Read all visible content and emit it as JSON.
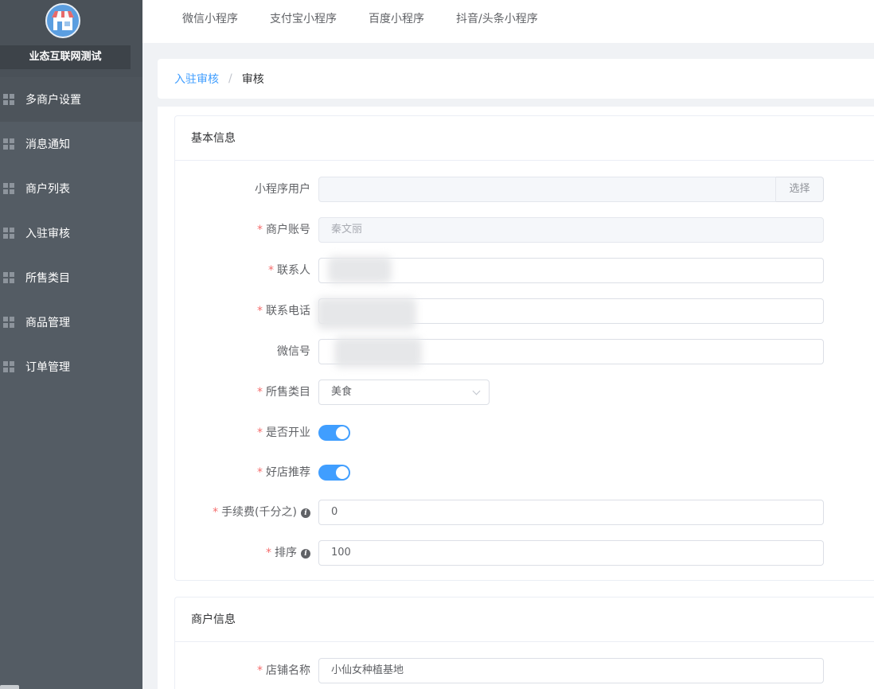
{
  "sidebar": {
    "brand_name": "业态互联网测试",
    "items": [
      {
        "label": "多商户设置",
        "active": true
      },
      {
        "label": "消息通知",
        "active": false
      },
      {
        "label": "商户列表",
        "active": false
      },
      {
        "label": "入驻审核",
        "active": false
      },
      {
        "label": "所售类目",
        "active": false
      },
      {
        "label": "商品管理",
        "active": false
      },
      {
        "label": "订单管理",
        "active": false
      }
    ]
  },
  "topbar": {
    "tabs": [
      "微信小程序",
      "支付宝小程序",
      "百度小程序",
      "抖音/头条小程序"
    ]
  },
  "breadcrumb": {
    "parent": "入驻审核",
    "separator": "/",
    "current": "审核"
  },
  "basic_info": {
    "title": "基本信息",
    "fields": {
      "mini_user": {
        "label": "小程序用户",
        "button": "选择",
        "value": ""
      },
      "account": {
        "label": "商户账号",
        "value": "秦文丽"
      },
      "contact": {
        "label": "联系人",
        "value": ""
      },
      "phone": {
        "label": "联系电话",
        "value": ""
      },
      "wechat": {
        "label": "微信号",
        "value": ""
      },
      "category": {
        "label": "所售类目",
        "value": "美食"
      },
      "is_open": {
        "label": "是否开业",
        "value": true
      },
      "recommend": {
        "label": "好店推荐",
        "value": true
      },
      "fee": {
        "label": "手续费(千分之)",
        "value": "0"
      },
      "sort": {
        "label": "排序",
        "value": "100"
      }
    }
  },
  "merchant_info": {
    "title": "商户信息",
    "fields": {
      "shop_name": {
        "label": "店铺名称",
        "value": "小仙女种植基地"
      }
    }
  },
  "required_mark": "*",
  "info_icon_glyph": "i",
  "colors": {
    "primary": "#409eff",
    "sidebar_bg": "#545c64",
    "required": "#f56c6c"
  }
}
